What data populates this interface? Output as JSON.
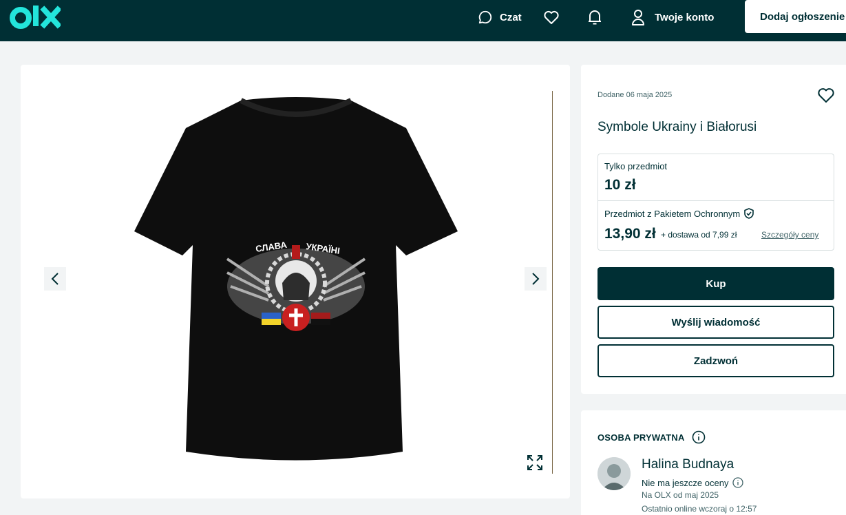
{
  "header": {
    "logo_text": "olx",
    "chat_label": "Czat",
    "account_label": "Twoje konto",
    "add_label": "Dodaj ogłoszenie"
  },
  "gallery": {
    "shirt_text_left": "СЛАВА",
    "shirt_text_right": "УКРАЇНІ"
  },
  "listing": {
    "posted": "Dodane 06 maja 2025",
    "title": "Symbole Ukrainy i Białorusi",
    "item_only_label": "Tylko przedmiot",
    "item_only_price": "10 zł",
    "protected_label": "Przedmiot z Pakietem Ochronnym",
    "protected_price": "13,90 zł",
    "delivery": "+ dostawa od 7,99 zł",
    "price_details_link": "Szczegóły ceny",
    "buy_label": "Kup",
    "message_label": "Wyślij wiadomość",
    "call_label": "Zadzwoń"
  },
  "seller": {
    "type": "OSOBA PRYWATNA",
    "name": "Halina Budnaya",
    "rating": "Nie ma jeszcze oceny",
    "since": "Na OLX od maj 2025",
    "last_online": "Ostatnio online wczoraj o 12:57"
  },
  "colors": {
    "header_bg": "#002f34",
    "accent_teal": "#23e5db",
    "page_bg": "#f2f4f5",
    "primary_text": "#002f34"
  }
}
